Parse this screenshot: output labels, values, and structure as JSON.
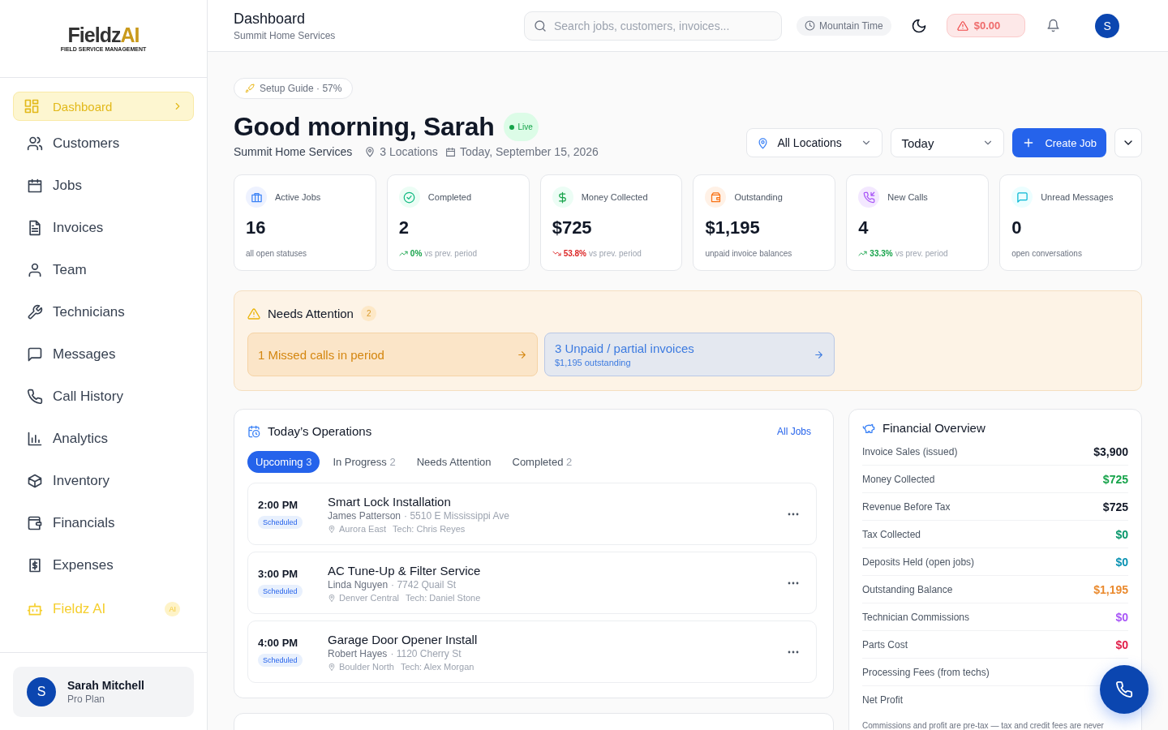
{
  "sidebar": {
    "logo": {
      "name": "Fieldz",
      "accent": "AI",
      "tagline": "FIELD SERVICE MANAGEMENT"
    },
    "items": [
      {
        "label": "Dashboard",
        "kind": "link",
        "selected": true
      },
      {
        "label": "Customers",
        "kind": "link",
        "selected": false
      },
      {
        "label": "Jobs",
        "kind": "link",
        "selected": false
      },
      {
        "label": "Invoices",
        "kind": "link",
        "selected": false
      },
      {
        "label": "Team",
        "kind": "link",
        "selected": false
      },
      {
        "label": "Technicians",
        "kind": "link",
        "selected": false
      },
      {
        "label": "Messages",
        "kind": "link",
        "selected": false
      },
      {
        "label": "Call History",
        "kind": "link",
        "selected": false
      },
      {
        "label": "Analytics",
        "kind": "link",
        "selected": false
      },
      {
        "label": "Inventory",
        "kind": "link",
        "selected": false
      },
      {
        "label": "Financials",
        "kind": "link",
        "selected": false
      },
      {
        "label": "Expenses",
        "kind": "link",
        "selected": false
      },
      {
        "label": "Fieldz AI",
        "kind": "ai",
        "badge": "AI",
        "selected": false
      }
    ],
    "user": {
      "initial": "S",
      "name": "Sarah Mitchell",
      "plan": "Pro Plan"
    }
  },
  "header": {
    "title": "Dashboard",
    "subtitle": "Summit Home Services",
    "search": {
      "placeholder": "Search jobs, customers, invoices..."
    },
    "timezone": "Mountain Time",
    "balance": "$0.00",
    "avatar": "S"
  },
  "setup_guide": "Setup Guide · 57%",
  "greeting": {
    "title": "Good morning, Sarah",
    "live": "Live",
    "company": "Summit Home Services",
    "locations": "3 Locations",
    "date": "Today, September 15, 2026"
  },
  "controls": {
    "location": "All Locations",
    "period": "Today",
    "create": "Create Job"
  },
  "stats": [
    {
      "label": "Active Jobs",
      "value": "16",
      "note": "all open statuses"
    },
    {
      "label": "Completed",
      "value": "2",
      "trend": {
        "rising": true,
        "change": "0%",
        "text": "vs prev. period"
      }
    },
    {
      "label": "Money Collected",
      "value": "$725",
      "trend": {
        "rising": false,
        "change": "53.8%",
        "text": "vs prev. period"
      }
    },
    {
      "label": "Outstanding",
      "value": "$1,195",
      "note": "unpaid invoice balances"
    },
    {
      "label": "New Calls",
      "value": "4",
      "trend": {
        "rising": true,
        "change": "33.3%",
        "text": "vs prev. period"
      }
    },
    {
      "label": "Unread Messages",
      "value": "0",
      "note": "open conversations"
    }
  ],
  "needs_attention": {
    "title": "Needs Attention",
    "count": "2",
    "items": [
      {
        "kind": "warning",
        "title": "1 Missed calls in period"
      },
      {
        "kind": "info",
        "title": "3 Unpaid / partial invoices",
        "detail": "$1,195 outstanding"
      }
    ]
  },
  "operations": {
    "title": "Today’s Operations",
    "link": "All Jobs",
    "tabs": [
      {
        "label": "Upcoming",
        "count": "3",
        "selected": true
      },
      {
        "label": "In Progress",
        "count": "2",
        "selected": false
      },
      {
        "label": "Needs Attention",
        "selected": false
      },
      {
        "label": "Completed",
        "count": "2",
        "selected": false
      }
    ],
    "jobs": [
      {
        "time": "2:00 PM",
        "status": "Scheduled",
        "title": "Smart Lock Installation",
        "customer": "James Patterson",
        "address": "· 5510 E Mississippi Ave",
        "area": "Aurora East",
        "tech": "Tech: Chris Reyes"
      },
      {
        "time": "3:00 PM",
        "status": "Scheduled",
        "title": "AC Tune-Up & Filter Service",
        "customer": "Linda Nguyen",
        "address": "· 7742 Quail St",
        "area": "Denver Central",
        "tech": "Tech: Daniel Stone"
      },
      {
        "time": "4:00 PM",
        "status": "Scheduled",
        "title": "Garage Door Opener Install",
        "customer": "Robert Hayes",
        "address": "· 1120 Cherry St",
        "area": "Boulder North",
        "tech": "Tech: Alex Morgan"
      }
    ]
  },
  "financial": {
    "title": "Financial Overview",
    "rows": [
      {
        "label": "Invoice Sales (issued)",
        "value": "$3,900",
        "color": "#111827"
      },
      {
        "label": "Money Collected",
        "value": "$725",
        "color": "#16a34a"
      },
      {
        "label": "Revenue Before Tax",
        "value": "$725",
        "color": "#111827"
      },
      {
        "label": "Tax Collected",
        "value": "$0",
        "color": "#059669"
      },
      {
        "label": "Deposits Held (open jobs)",
        "value": "$0",
        "color": "#0891b2"
      },
      {
        "label": "Outstanding Balance",
        "value": "$1,195",
        "color": "#ea8a2e"
      },
      {
        "label": "Technician Commissions",
        "value": "$0",
        "color": "#a855f7"
      },
      {
        "label": "Parts Cost",
        "value": "$0",
        "color": "#e11d48"
      },
      {
        "label": "Processing Fees (from techs)"
      },
      {
        "label": "Net Profit"
      }
    ],
    "note": "Commissions and profit are pre-tax — tax and credit fees are never"
  }
}
